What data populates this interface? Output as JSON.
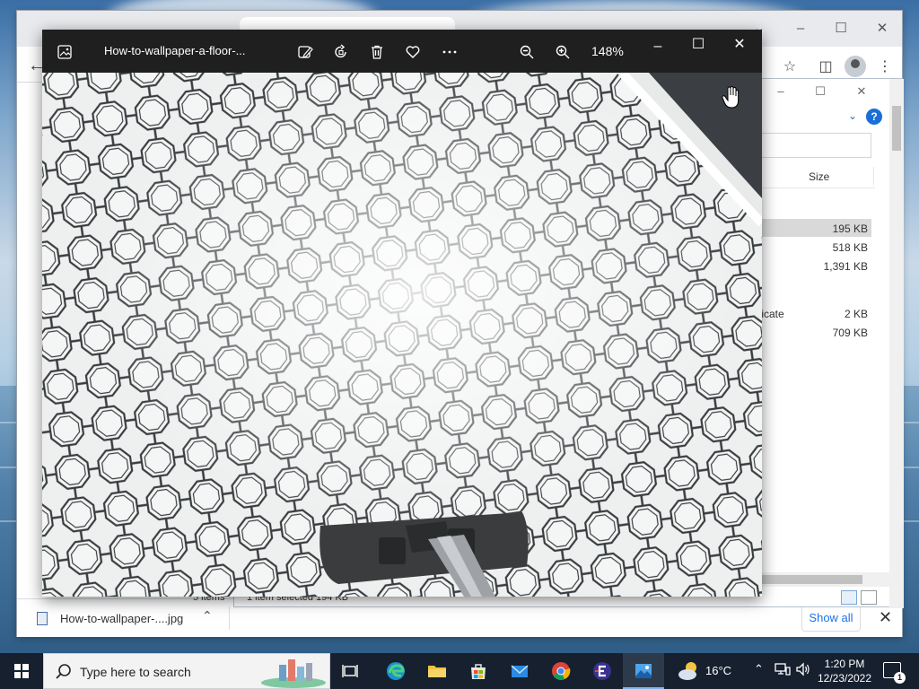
{
  "photos": {
    "title": "How-to-wallpaper-a-floor-...",
    "zoom": "148%",
    "toolbar": [
      "edit-image",
      "rotate",
      "delete",
      "favorite",
      "more",
      "zoom-out",
      "zoom-in"
    ]
  },
  "explorer": {
    "column_size": "Size",
    "files": [
      {
        "name": "",
        "size": "195 KB",
        "selected": true
      },
      {
        "name": "",
        "size": "518 KB"
      },
      {
        "name": "",
        "size": "1,391 KB"
      },
      {
        "name": "ficate",
        "size": "2 KB"
      },
      {
        "name": "",
        "size": "709 KB"
      }
    ],
    "status": {
      "items": "5 items",
      "selected": "1 item selected  194 KB"
    },
    "help": "?"
  },
  "chrome": {
    "download": {
      "filename": "How-to-wallpaper-....jpg",
      "show_all": "Show all"
    }
  },
  "taskbar": {
    "search_placeholder": "Type here to search",
    "temperature": "16°C",
    "time": "1:20 PM",
    "date": "12/23/2022",
    "notifications": "1"
  },
  "colors": {
    "taskbar": "#16202e",
    "photos_chrome": "#1f1f1f",
    "accent": "#1a73e8"
  }
}
